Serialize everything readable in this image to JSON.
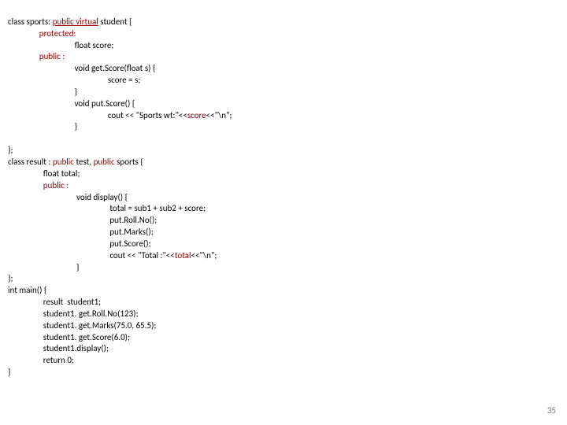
{
  "code": {
    "l1a": "class sports: ",
    "l1b": "public virtual",
    "l1c": " student {",
    "l2": "protected:",
    "l3": "float score;",
    "l4": "public :",
    "l5": "void get.Score(float s) {",
    "l6": "score = s;",
    "l7": "}",
    "l8": "void put.Score() {",
    "l9a": "cout << \"Sports wt:\"<<",
    "l9b": "score",
    "l9c": "<<\"\\n\";",
    "l10": "}",
    "l11": "};",
    "l12a": "class result : ",
    "l12b": "public",
    "l12c": " test, ",
    "l12d": "public",
    "l12e": " sports {",
    "l13": "float total;",
    "l14": "public :",
    "l15": "void display() {",
    "l16": "total = sub1 + sub2 + score;",
    "l17": "put.Roll.No();",
    "l18": "put.Marks();",
    "l19": "put.Score();",
    "l20a": "cout << \"Total :\"<<",
    "l20b": "total",
    "l20c": "<<\"\\n\";",
    "l21": "}",
    "l22": "};",
    "l23": "int main() {",
    "l24": "result  student1;",
    "l25": "student1. get.Roll.No(123);",
    "l26": "student1. get.Marks(75.0, 65.5);",
    "l27": "student1. get.Score(6.0);",
    "l28": "student1.display();",
    "l29": "return 0;",
    "l30": "}"
  },
  "pageNumber": "35"
}
